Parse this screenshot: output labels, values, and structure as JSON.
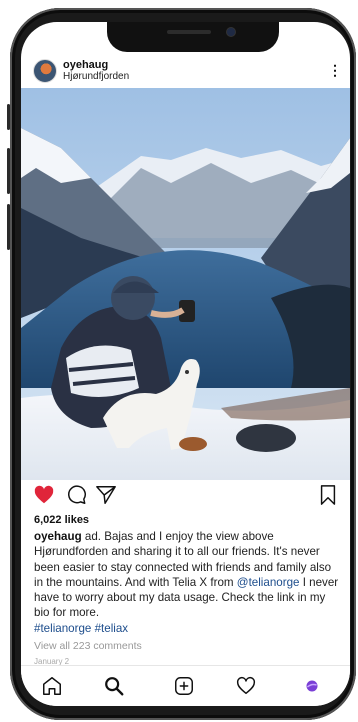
{
  "post": {
    "username": "oyehaug",
    "location": "Hjørundfjorden",
    "more_icon": "⋮",
    "likes": "6,022 likes",
    "caption": {
      "author": "oyehaug",
      "text_1": " ad. Bajas and I enjoy the view above Hjørundforden and sharing it to all our friends. It's never been easier to stay connected with friends and family also in the mountains. And with Telia X from ",
      "mention": "@telianorge",
      "text_2": " I never have to worry about my data usage. Check the link in my bio for more.",
      "hashtags": "#telianorge #teliax"
    },
    "comments_link": "View all 223 comments",
    "date": "January 2"
  },
  "icons": {
    "actions": [
      "heart-filled-icon",
      "comment-icon",
      "share-icon",
      "bookmark-icon"
    ],
    "tabs": [
      "home-icon",
      "search-icon",
      "new-post-icon",
      "activity-icon",
      "profile-icon"
    ]
  },
  "colors": {
    "like": "#e0253a",
    "link": "#1d4d8c",
    "profile_tab": "#7a3fd6"
  }
}
